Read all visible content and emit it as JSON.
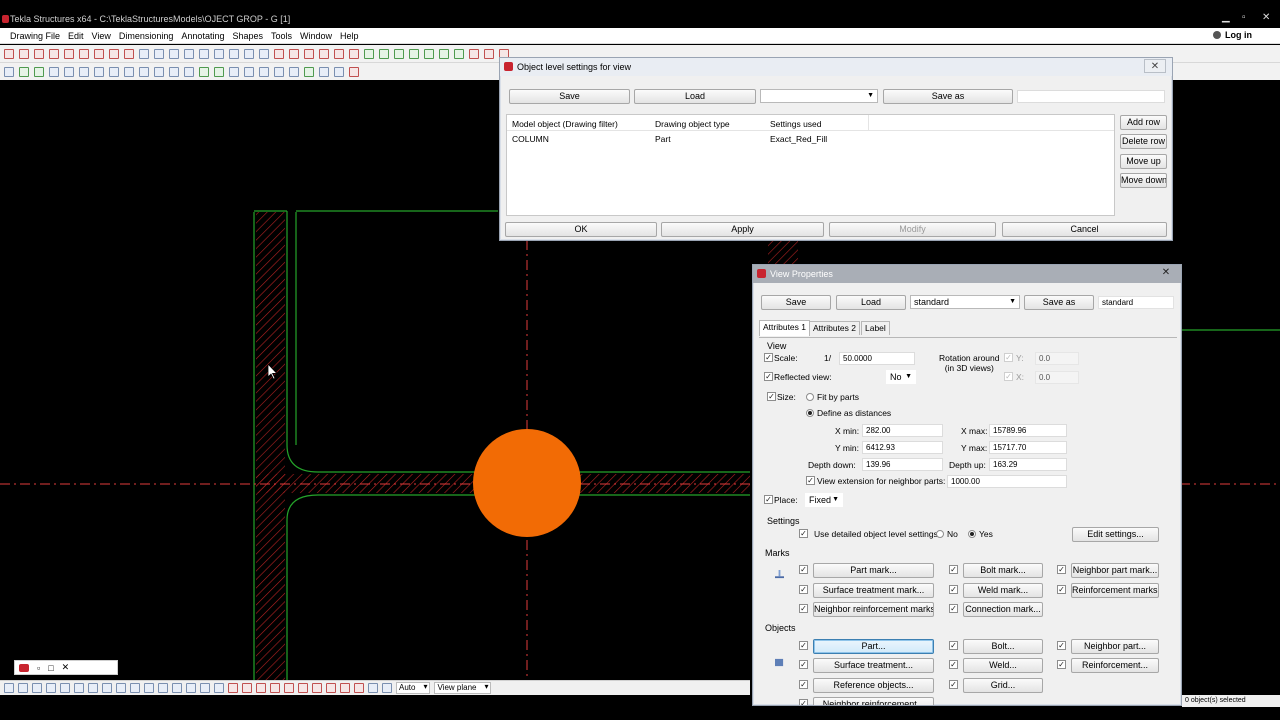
{
  "app": {
    "title": "Tekla Structures x64 - C:\\TeklaStructuresModels\\OJECT GROP - G   [1]",
    "login": "Log in"
  },
  "menu": [
    "Drawing File",
    "Edit",
    "View",
    "Dimensioning",
    "Annotating",
    "Shapes",
    "Tools",
    "Window",
    "Help"
  ],
  "colors": {
    "accent_red": "#c8242f",
    "hatch_red": "#b32222",
    "outline_green": "#25a32a",
    "column_orange": "#f26b05",
    "centerline_red": "#e23b3b"
  },
  "object_dialog": {
    "title": "Object level settings for view",
    "save": "Save",
    "load": "Load",
    "save_as": "Save as",
    "settings_combo": "",
    "save_as_field": "",
    "columns": [
      "Model object (Drawing filter)",
      "Drawing object type",
      "Settings used"
    ],
    "rows": [
      {
        "filter": "COLUMN",
        "type": "Part",
        "settings": "Exact_Red_Fill"
      }
    ],
    "add_row": "Add row",
    "delete_row": "Delete row",
    "move_up": "Move up",
    "move_down": "Move down",
    "ok": "OK",
    "apply": "Apply",
    "modify": "Modify",
    "cancel": "Cancel"
  },
  "view_dialog": {
    "title": "View Properties",
    "save": "Save",
    "load": "Load",
    "settings_combo": "standard",
    "save_as": "Save as",
    "save_as_field": "standard",
    "tabs": [
      "Attributes 1",
      "Attributes 2",
      "Label"
    ],
    "view_group": "View",
    "scale_label": "Scale:",
    "scale_prefix": "1/",
    "scale_value": "50.0000",
    "rotation_label": "Rotation around\n(in 3D views)",
    "rot_y_label": "Y:",
    "rot_y_value": "0.0",
    "rot_x_label": "X:",
    "rot_x_value": "0.0",
    "reflected_label": "Reflected view:",
    "reflected_value": "No",
    "size_label": "Size:",
    "fit_by_parts": "Fit by parts",
    "define_as_distances": "Define as distances",
    "xmin_label": "X min:",
    "xmin_value": "282.00",
    "xmax_label": "X max:",
    "xmax_value": "15789.96",
    "ymin_label": "Y min:",
    "ymin_value": "6412.93",
    "ymax_label": "Y max:",
    "ymax_value": "15717.70",
    "depth_down_label": "Depth down:",
    "depth_down_value": "139.96",
    "depth_up_label": "Depth up:",
    "depth_up_value": "163.29",
    "extension_label": "View extension for neighbor parts:",
    "extension_value": "1000.00",
    "place_label": "Place:",
    "place_value": "Fixed",
    "settings_group": "Settings",
    "use_detailed": "Use detailed object level settings",
    "no": "No",
    "yes": "Yes",
    "edit_settings": "Edit settings...",
    "marks_group": "Marks",
    "part_mark": "Part mark...",
    "bolt_mark": "Bolt mark...",
    "neighbor_part_mark": "Neighbor part mark...",
    "surface_treatment_mark": "Surface treatment mark...",
    "weld_mark": "Weld mark...",
    "reinforcement_marks": "Reinforcement marks...",
    "neighbor_reinforcement_marks": "Neighbor reinforcement marks...",
    "connection_mark": "Connection mark...",
    "objects_group": "Objects",
    "part": "Part...",
    "bolt": "Bolt...",
    "neighbor_part": "Neighbor part...",
    "surface_treatment": "Surface treatment...",
    "weld": "Weld...",
    "reinforcement": "Reinforcement...",
    "reference_objects": "Reference objects...",
    "grid": "Grid...",
    "neighbor_reinforcement": "Neighbor reinforcement..."
  },
  "bottom_toolbar": {
    "snap_mode": "Auto",
    "plane": "View plane"
  },
  "status": {
    "selection": "0 object(s) selected"
  }
}
